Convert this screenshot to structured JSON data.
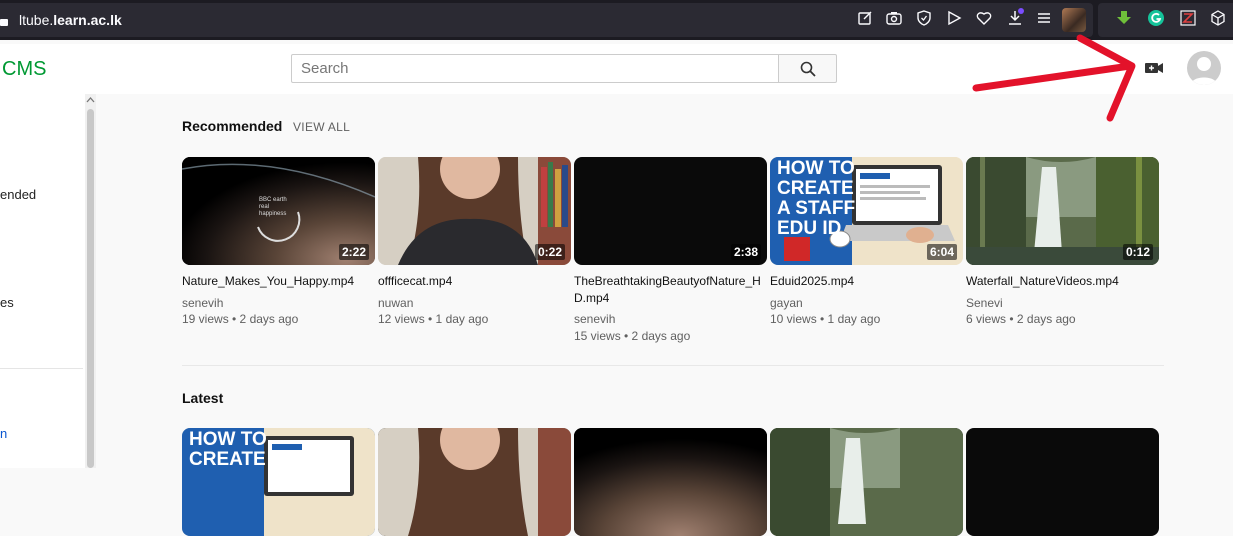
{
  "browser": {
    "url_prefix": "ltube.",
    "url_domain": "learn.ac.lk"
  },
  "header": {
    "brand": "CMS",
    "search_placeholder": "Search"
  },
  "sidebar": {
    "items": [
      "ended",
      "es",
      "n"
    ]
  },
  "recommended": {
    "title": "Recommended",
    "view_all": "VIEW ALL",
    "videos": [
      {
        "title": "Nature_Makes_You_Happy.mp4",
        "author": "senevih",
        "meta": "19 views • 2 days ago",
        "duration": "2:22"
      },
      {
        "title": "offficecat.mp4",
        "author": "nuwan",
        "meta": "12 views • 1 day ago",
        "duration": "0:22"
      },
      {
        "title": "TheBreathtakingBeautyofNature_HD.mp4",
        "author": "senevih",
        "meta": "15 views • 2 days ago",
        "duration": "2:38"
      },
      {
        "title": "Eduid2025.mp4",
        "author": "gayan",
        "meta": "10 views • 1 day ago",
        "duration": "6:04"
      },
      {
        "title": "Waterfall_NatureVideos.mp4",
        "author": "Senevi",
        "meta": "6 views • 2 days ago",
        "duration": "0:12"
      }
    ]
  },
  "latest": {
    "title": "Latest"
  },
  "thumb_text": {
    "eduid_line1": "HOW TO",
    "eduid_line2": "CREATE",
    "eduid_line3": "A STAFF",
    "eduid_line4": "EDU ID",
    "bbc_line1": "BBC earth",
    "bbc_line2": "real",
    "bbc_line3": "happiness"
  },
  "colors": {
    "brand": "#009933",
    "annotation_arrow": "#e3122a"
  }
}
